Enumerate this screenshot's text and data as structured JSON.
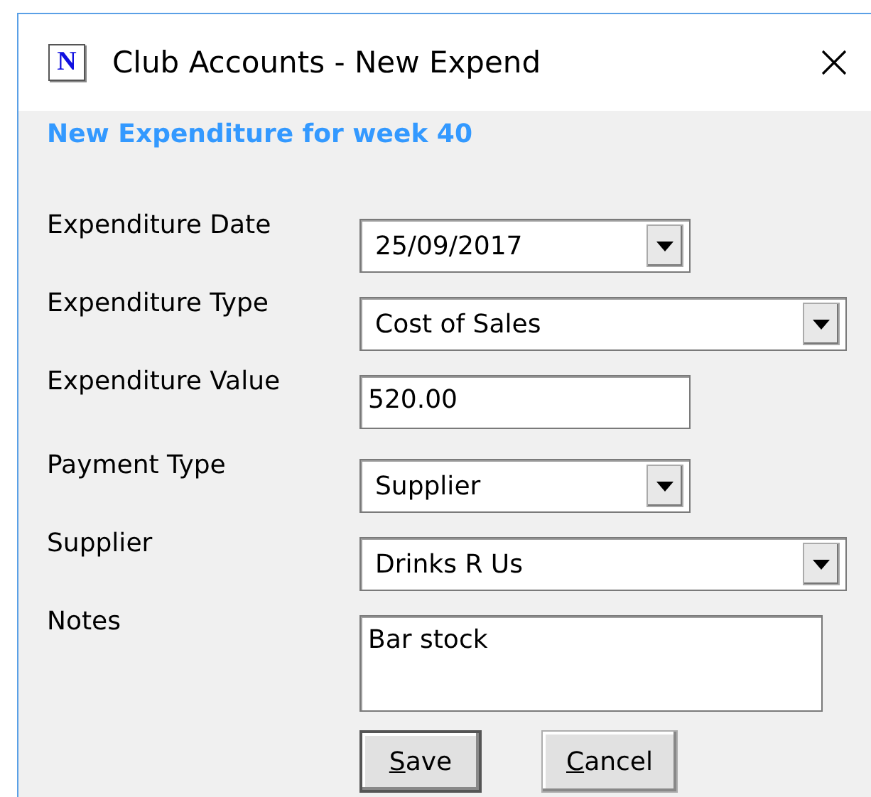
{
  "window": {
    "title": "Club Accounts - New Expend",
    "icon": "N"
  },
  "heading": "New Expenditure for week 40",
  "fields": [
    {
      "label": "Expenditure Date",
      "kind": "dropdown",
      "value": "25/09/2017"
    },
    {
      "label": "Expenditure Type",
      "kind": "dropdown",
      "value": "Cost of Sales"
    },
    {
      "label": "Expenditure Value",
      "kind": "text",
      "value": "520.00"
    },
    {
      "label": "Payment Type",
      "kind": "dropdown",
      "value": "Supplier"
    },
    {
      "label": "Supplier",
      "kind": "dropdown",
      "value": "Drinks R Us"
    },
    {
      "label": "Notes",
      "kind": "textarea",
      "value": "Bar stock"
    }
  ],
  "buttons": [
    {
      "label": "Save",
      "default": true
    },
    {
      "label": "Cancel",
      "default": false
    }
  ]
}
